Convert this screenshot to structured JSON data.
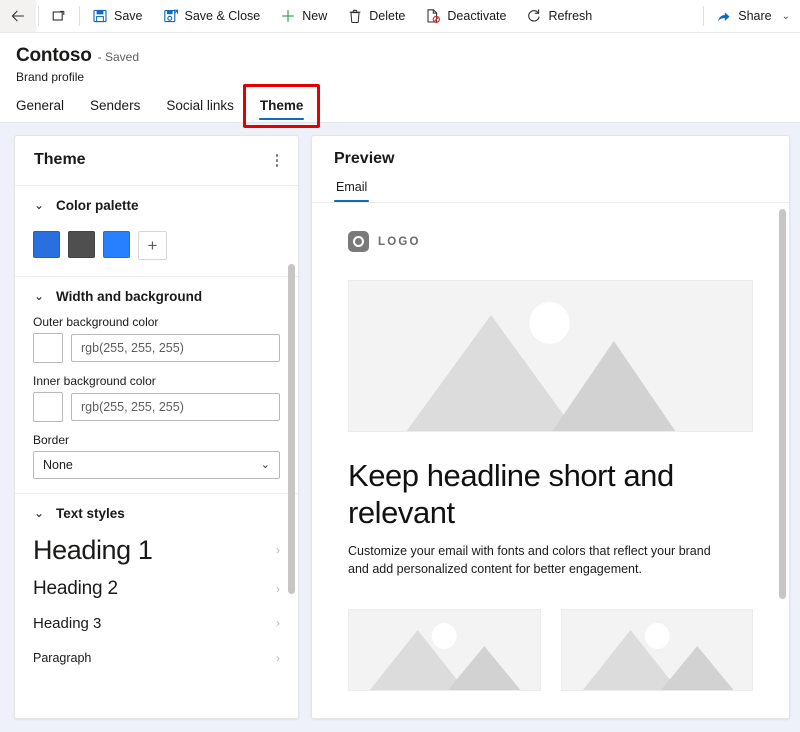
{
  "commandbar": {
    "back": {
      "label": "",
      "icon": "back-arrow-icon"
    },
    "popout": {
      "label": "",
      "icon": "open-in-new-window-icon"
    },
    "buttons": [
      {
        "label": "Save",
        "icon": "save-icon"
      },
      {
        "label": "Save & Close",
        "icon": "save-and-close-icon"
      },
      {
        "label": "New",
        "icon": "plus-icon"
      },
      {
        "label": "Delete",
        "icon": "trash-icon"
      },
      {
        "label": "Deactivate",
        "icon": "deactivate-icon"
      },
      {
        "label": "Refresh",
        "icon": "refresh-icon"
      }
    ],
    "share": {
      "label": "Share",
      "icon": "share-icon",
      "chevron": "⌄"
    }
  },
  "record": {
    "title": "Contoso",
    "saved_status": "- Saved",
    "subtitle": "Brand profile",
    "tabs": [
      {
        "label": "General",
        "active": false
      },
      {
        "label": "Senders",
        "active": false
      },
      {
        "label": "Social links",
        "active": false
      },
      {
        "label": "Theme",
        "active": true
      }
    ],
    "annotation_color": "#e30000",
    "accent_color": "#0f6cbd"
  },
  "theme_panel": {
    "title": "Theme",
    "overflow_icon": "more-options-icon",
    "sections": [
      {
        "title": "Color palette",
        "chevron": "⌄"
      },
      {
        "title": "Width and background",
        "chevron": "⌄"
      },
      {
        "title": "Text styles",
        "chevron": "⌄"
      }
    ],
    "palette": {
      "swatches": [
        "#2a6fe0",
        "#4f4f4f",
        "#2680ff"
      ],
      "add_label": "+"
    },
    "width_background": {
      "outer": {
        "label": "Outer background color",
        "value": "rgb(255, 255, 255)",
        "swatch": "#ffffff"
      },
      "inner": {
        "label": "Inner background color",
        "value": "rgb(255, 255, 255)",
        "swatch": "#ffffff"
      },
      "border": {
        "label": "Border",
        "value": "None",
        "chevron": "⌄"
      }
    },
    "text_styles": [
      {
        "label": "Heading 1",
        "arrow": "›"
      },
      {
        "label": "Heading 2",
        "arrow": "›"
      },
      {
        "label": "Heading 3",
        "arrow": "›"
      },
      {
        "label": "Paragraph",
        "arrow": "›"
      }
    ]
  },
  "preview_panel": {
    "title": "Preview",
    "tabs": [
      {
        "label": "Email",
        "active": true
      }
    ],
    "email": {
      "logo_text": "LOGO",
      "hero_alt": "mountain-placeholder-image",
      "headline": "Keep headline short and relevant",
      "body": "Customize your email with fonts and colors that reflect your brand and add personalized content for better engagement.",
      "cards": [
        {
          "alt": "placeholder-image"
        },
        {
          "alt": "placeholder-image"
        }
      ]
    }
  }
}
